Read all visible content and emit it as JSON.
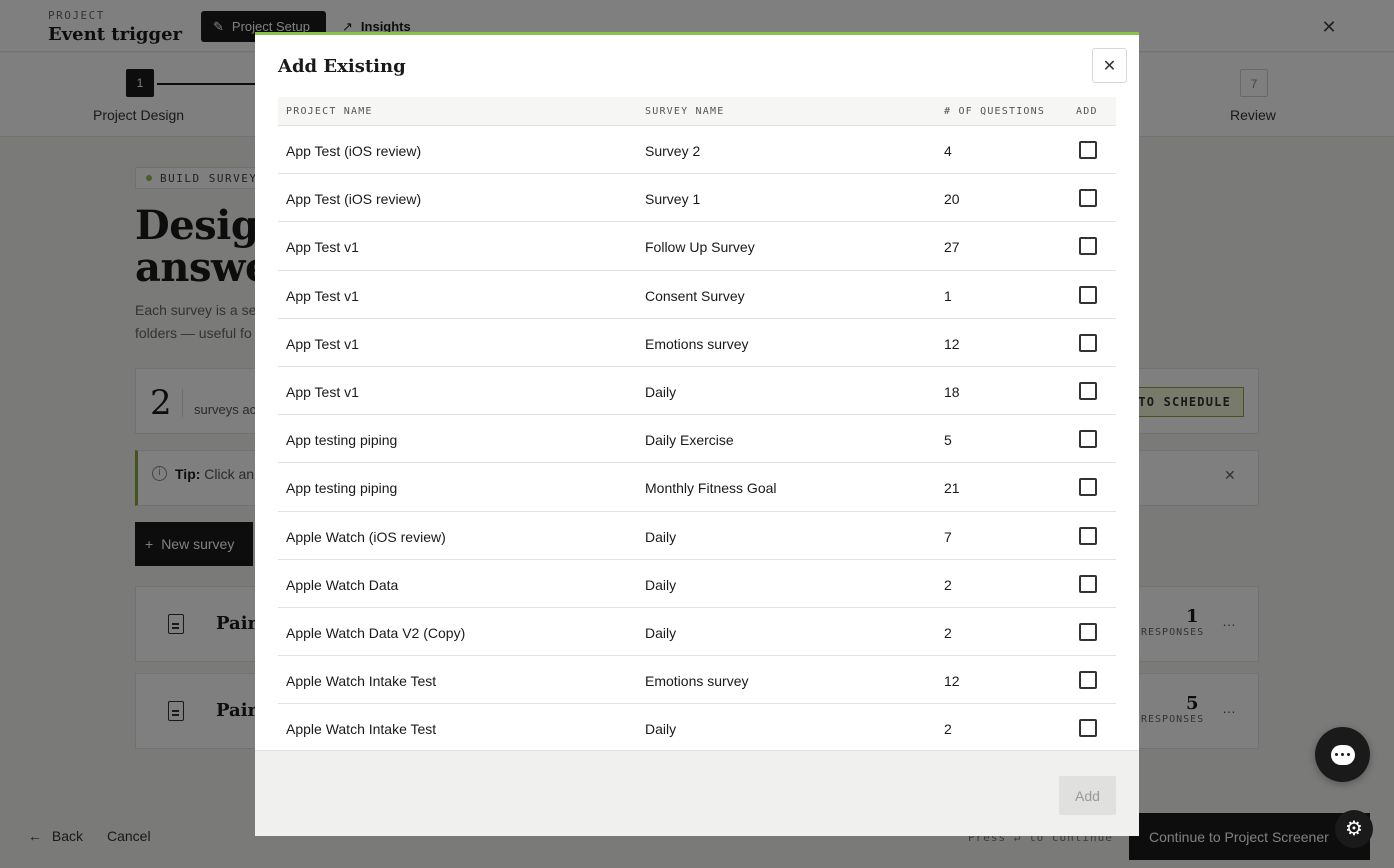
{
  "header": {
    "kicker": "PROJECT",
    "title": "Event trigger",
    "tab_setup": "Project Setup",
    "tab_insights": "Insights"
  },
  "steps": {
    "first_num": "1",
    "first_label": "Project Design",
    "last_num": "7",
    "last_label": "Review"
  },
  "build": {
    "pill": "BUILD SURVEYS",
    "hero_line1": "Design",
    "hero_line2": "answer",
    "desc_line1": "Each survey is a se",
    "desc_line2": "folders — useful fo"
  },
  "summary": {
    "count": "2",
    "label": "surveys ac",
    "schedule_btn": "TO SCHEDULE"
  },
  "tip": {
    "bold": "Tip:",
    "text": "Click an"
  },
  "new_survey_label": "New survey",
  "survey_rows": [
    {
      "name": "Pain",
      "responses": "1",
      "responses_label": "RESPONSES"
    },
    {
      "name": "Pain",
      "responses": "5",
      "responses_label": "RESPONSES"
    }
  ],
  "footer": {
    "back": "Back",
    "cancel": "Cancel",
    "press_hint": "Press ↵ to continue",
    "continue": "Continue to Project Screener"
  },
  "modal": {
    "title": "Add Existing",
    "columns": [
      "PROJECT NAME",
      "SURVEY NAME",
      "# OF QUESTIONS",
      "ADD"
    ],
    "rows": [
      {
        "project": "App Test (iOS review)",
        "survey": "Survey 2",
        "questions": "4",
        "checked": false
      },
      {
        "project": "App Test (iOS review)",
        "survey": "Survey 1",
        "questions": "20",
        "checked": false
      },
      {
        "project": "App Test v1",
        "survey": "Follow Up Survey",
        "questions": "27",
        "checked": false
      },
      {
        "project": "App Test v1",
        "survey": "Consent Survey",
        "questions": "1",
        "checked": false
      },
      {
        "project": "App Test v1",
        "survey": "Emotions survey",
        "questions": "12",
        "checked": false
      },
      {
        "project": "App Test v1",
        "survey": "Daily",
        "questions": "18",
        "checked": false
      },
      {
        "project": "App testing piping",
        "survey": "Daily Exercise",
        "questions": "5",
        "checked": false
      },
      {
        "project": "App testing piping",
        "survey": "Monthly Fitness Goal",
        "questions": "21",
        "checked": false
      },
      {
        "project": "Apple Watch (iOS review)",
        "survey": "Daily",
        "questions": "7",
        "checked": false
      },
      {
        "project": "Apple Watch Data",
        "survey": "Daily",
        "questions": "2",
        "checked": false
      },
      {
        "project": "Apple Watch Data V2 (Copy)",
        "survey": "Daily",
        "questions": "2",
        "checked": false
      },
      {
        "project": "Apple Watch Intake Test",
        "survey": "Emotions survey",
        "questions": "12",
        "checked": false
      },
      {
        "project": "Apple Watch Intake Test",
        "survey": "Daily",
        "questions": "2",
        "checked": false
      }
    ],
    "add_button": "Add"
  },
  "colors": {
    "accent_green": "#8bc34a",
    "dark": "#1a1a1a"
  },
  "icons": {
    "modal_close": "close-icon",
    "chat": "chat-icon",
    "settings": "gear-icon"
  }
}
